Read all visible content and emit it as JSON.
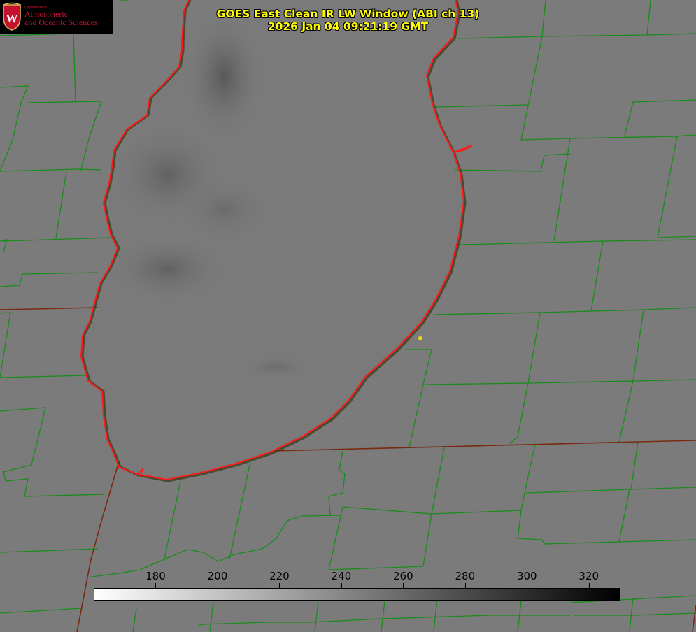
{
  "title": {
    "line1": "GOES East Clean IR LW Window (ABI ch 13)",
    "line2": "2026 Jan 04 09:21:19 GMT"
  },
  "logo": {
    "dept": "Department of",
    "name_line1": "Atmospheric",
    "name_line2": "and Oceanic Sciences",
    "crest_letter": "W"
  },
  "colorbar": {
    "min": 160,
    "max": 330,
    "ticks": [
      "180",
      "200",
      "220",
      "240",
      "260",
      "280",
      "300",
      "320"
    ],
    "from_color": "#ffffff",
    "to_color": "#000000"
  },
  "colors": {
    "background": "#7c7c7c",
    "county_lines": "#1a8c1a",
    "lake_outline": "#ff1a1a",
    "title_text": "#ffff00",
    "marker": "#e6d21a"
  },
  "icons": {
    "crest": "uw-crest-icon",
    "marker": "location-dot-icon"
  }
}
